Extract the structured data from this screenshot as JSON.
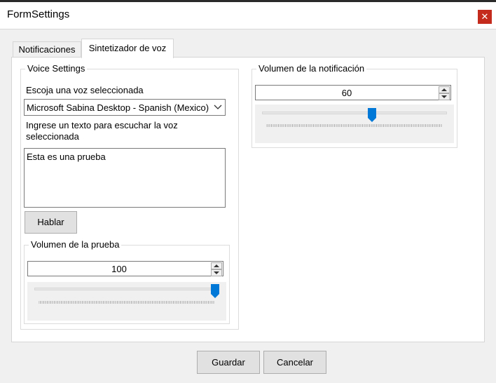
{
  "window": {
    "title": "FormSettings",
    "close_glyph": "✕"
  },
  "tabs": [
    {
      "label": "Notificaciones"
    },
    {
      "label": "Sintetizador de voz"
    }
  ],
  "voice_settings": {
    "legend": "Voice Settings",
    "choose_voice_label": "Escoja una voz seleccionada",
    "voice_selected": "Microsoft Sabina Desktop - Spanish (Mexico)",
    "test_text_label_line1": "Ingrese un texto para escuchar la voz",
    "test_text_label_line2": "seleccionada",
    "test_text_value": "Esta es una prueba",
    "speak_button": "Hablar"
  },
  "test_volume": {
    "legend": "Volumen de la prueba",
    "value": "100",
    "level_percent": 100
  },
  "notification_volume": {
    "legend": "Volumen de la notificación",
    "value": "60",
    "level_percent": 60
  },
  "footer": {
    "save_button": "Guardar",
    "cancel_button": "Cancelar"
  },
  "colors": {
    "close_button": "#c42b1c",
    "slider_thumb": "#0078d7"
  }
}
